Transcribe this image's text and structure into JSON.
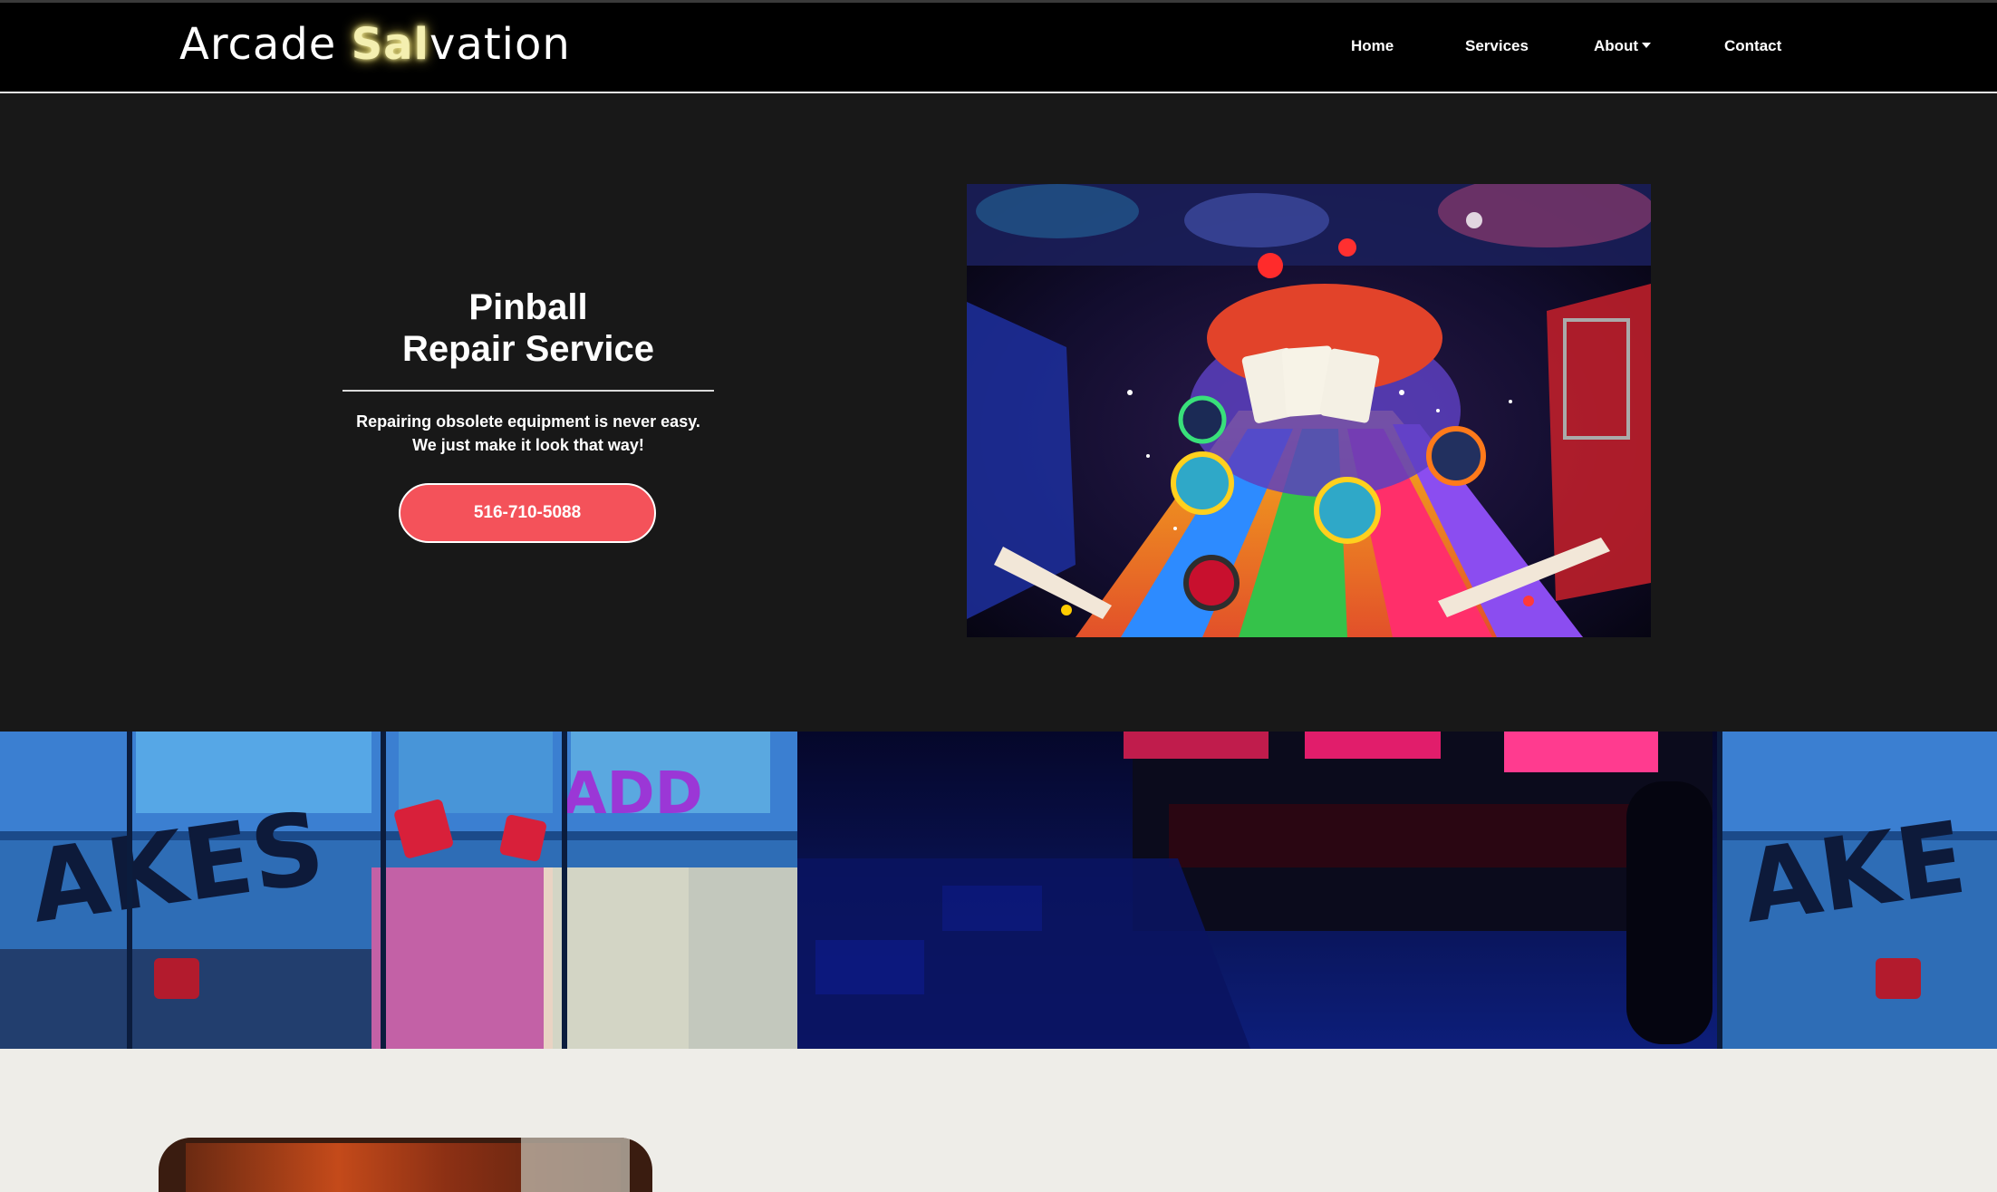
{
  "brand": {
    "prefix": "Arcade ",
    "highlight": "Sal",
    "suffix": "vation"
  },
  "nav": {
    "home": "Home",
    "services": "Services",
    "about": "About",
    "contact": "Contact"
  },
  "hero": {
    "title_line1": "Pinball",
    "title_line2": "Repair Service",
    "tagline_line1": "Repairing obsolete equipment is never easy.",
    "tagline_line2": "We just make it look that way!",
    "phone": "516-710-5088"
  },
  "images": {
    "hero_photo": "pinball-playfield-photo",
    "banner_photo": "arcade-games-photo",
    "section_photo": "arcade-photo"
  },
  "colors": {
    "accent": "#f4525a",
    "nav_bg": "#000000",
    "hero_bg": "#181818",
    "page_bg": "#eeede8",
    "brand_glow": "#f4efb0"
  }
}
